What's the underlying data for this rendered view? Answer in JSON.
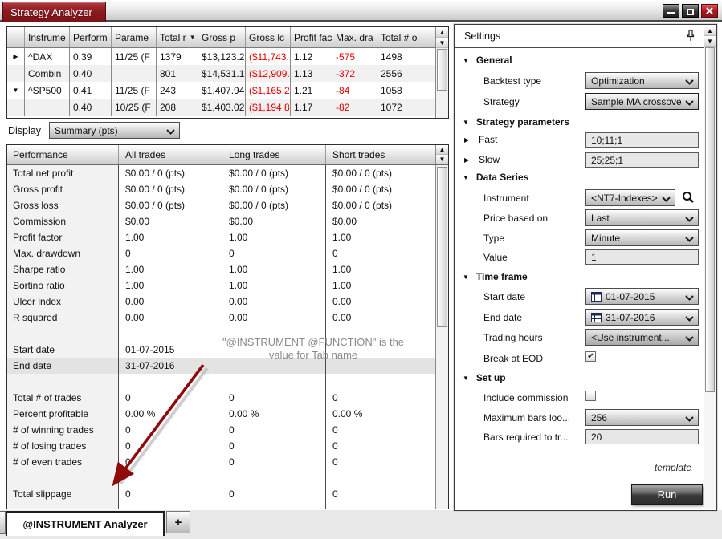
{
  "window": {
    "title": "Strategy Analyzer"
  },
  "icons": {
    "minimize": "css-bar",
    "maximize": "css-square",
    "close": "svg-x",
    "pin": "svg-pushpin",
    "search": "svg-magnifier",
    "calendar": "svg-calendar",
    "dropdown_chevron": "svg-chevron-down",
    "scroll_up": "▲",
    "scroll_down": "▼",
    "sort": "▼",
    "section_open": "▼",
    "expand_row": "▶",
    "check": "✔"
  },
  "results_grid": {
    "headers": [
      "Instrume",
      "Perform",
      "Parame",
      "Total r",
      "Gross p",
      "Gross lc",
      "Profit fac",
      "Max. dra",
      "Total # o"
    ],
    "rows": [
      [
        "▶",
        "^DAX",
        "0.39",
        "11/25 (F",
        "1379",
        "$13,123.2",
        "($11,743.",
        "1.12",
        "-575",
        "1498"
      ],
      [
        "",
        "Combin",
        "0.40",
        "",
        "801",
        "$14,531.1",
        "($12,909.",
        "1.13",
        "-372",
        "2556"
      ],
      [
        "▼",
        "^SP500",
        "0.41",
        "11/25 (F",
        "243",
        "$1,407.94",
        "($1,165.2",
        "1.21",
        "-84",
        "1058"
      ],
      [
        "",
        "",
        "0.40",
        "10/25 (F",
        "208",
        "$1,403.02",
        "($1,194.8",
        "1.17",
        "-82",
        "1072"
      ]
    ]
  },
  "display": {
    "label": "Display",
    "value": "Summary (pts)"
  },
  "performance_grid": {
    "headers": [
      "Performance",
      "All trades",
      "Long trades",
      "Short trades"
    ],
    "rows": [
      [
        "Total net profit",
        "$0.00 / 0 (pts)",
        "$0.00 / 0 (pts)",
        "$0.00 / 0 (pts)"
      ],
      [
        "Gross profit",
        "$0.00 / 0 (pts)",
        "$0.00 / 0 (pts)",
        "$0.00 / 0 (pts)"
      ],
      [
        "Gross loss",
        "$0.00 / 0 (pts)",
        "$0.00 / 0 (pts)",
        "$0.00 / 0 (pts)"
      ],
      [
        "Commission",
        "$0.00",
        "$0.00",
        "$0.00"
      ],
      [
        "Profit factor",
        "1.00",
        "1.00",
        "1.00"
      ],
      [
        "Max. drawdown",
        "0",
        "0",
        "0"
      ],
      [
        "Sharpe ratio",
        "1.00",
        "1.00",
        "1.00"
      ],
      [
        "Sortino ratio",
        "1.00",
        "1.00",
        "1.00"
      ],
      [
        "Ulcer index",
        "0.00",
        "0.00",
        "0.00"
      ],
      [
        "R squared",
        "0.00",
        "0.00",
        "0.00"
      ],
      [
        "",
        "",
        "",
        ""
      ],
      [
        "Start date",
        "01-07-2015",
        "",
        ""
      ],
      [
        "End date",
        "31-07-2016",
        "",
        ""
      ],
      [
        "",
        "",
        "",
        ""
      ],
      [
        "Total # of trades",
        "0",
        "0",
        "0"
      ],
      [
        "Percent profitable",
        "0.00 %",
        "0.00 %",
        "0.00 %"
      ],
      [
        "# of winning trades",
        "0",
        "0",
        "0"
      ],
      [
        "# of losing trades",
        "0",
        "0",
        "0"
      ],
      [
        "# of even trades",
        "0",
        "0",
        "0"
      ],
      [
        "",
        "",
        "",
        ""
      ],
      [
        "Total slippage",
        "0",
        "0",
        "0"
      ]
    ]
  },
  "annotation": {
    "line1": "\"@INSTRUMENT @FUNCTION\" is the",
    "line2": "value for Tab name"
  },
  "tab_bar": {
    "active_tab": "@INSTRUMENT Analyzer",
    "new_tab": "+"
  },
  "settings": {
    "title": "Settings",
    "general": {
      "header": "General",
      "backtest_label": "Backtest type",
      "backtest_value": "Optimization",
      "strategy_label": "Strategy",
      "strategy_value": "Sample MA crossove"
    },
    "strategy_parameters": {
      "header": "Strategy parameters",
      "fast_label": "Fast",
      "fast_value": "10;11;1",
      "slow_label": "Slow",
      "slow_value": "25;25;1"
    },
    "data_series": {
      "header": "Data Series",
      "instrument_label": "Instrument",
      "instrument_value": "<NT7-Indexes>",
      "price_label": "Price based on",
      "price_value": "Last",
      "type_label": "Type",
      "type_value": "Minute",
      "value_label": "Value",
      "value_value": "1"
    },
    "time_frame": {
      "header": "Time frame",
      "start_label": "Start date",
      "start_value": "01-07-2015",
      "end_label": "End date",
      "end_value": "31-07-2016",
      "hours_label": "Trading hours",
      "hours_value": "<Use instrument...",
      "eod_label": "Break at EOD"
    },
    "setup": {
      "header": "Set up",
      "commission_label": "Include commission",
      "maxbars_label": "Maximum bars loo...",
      "maxbars_value": "256",
      "barsreq_label": "Bars required to tr...",
      "barsreq_value": "20"
    },
    "template_link": "template",
    "run_button": "Run"
  }
}
